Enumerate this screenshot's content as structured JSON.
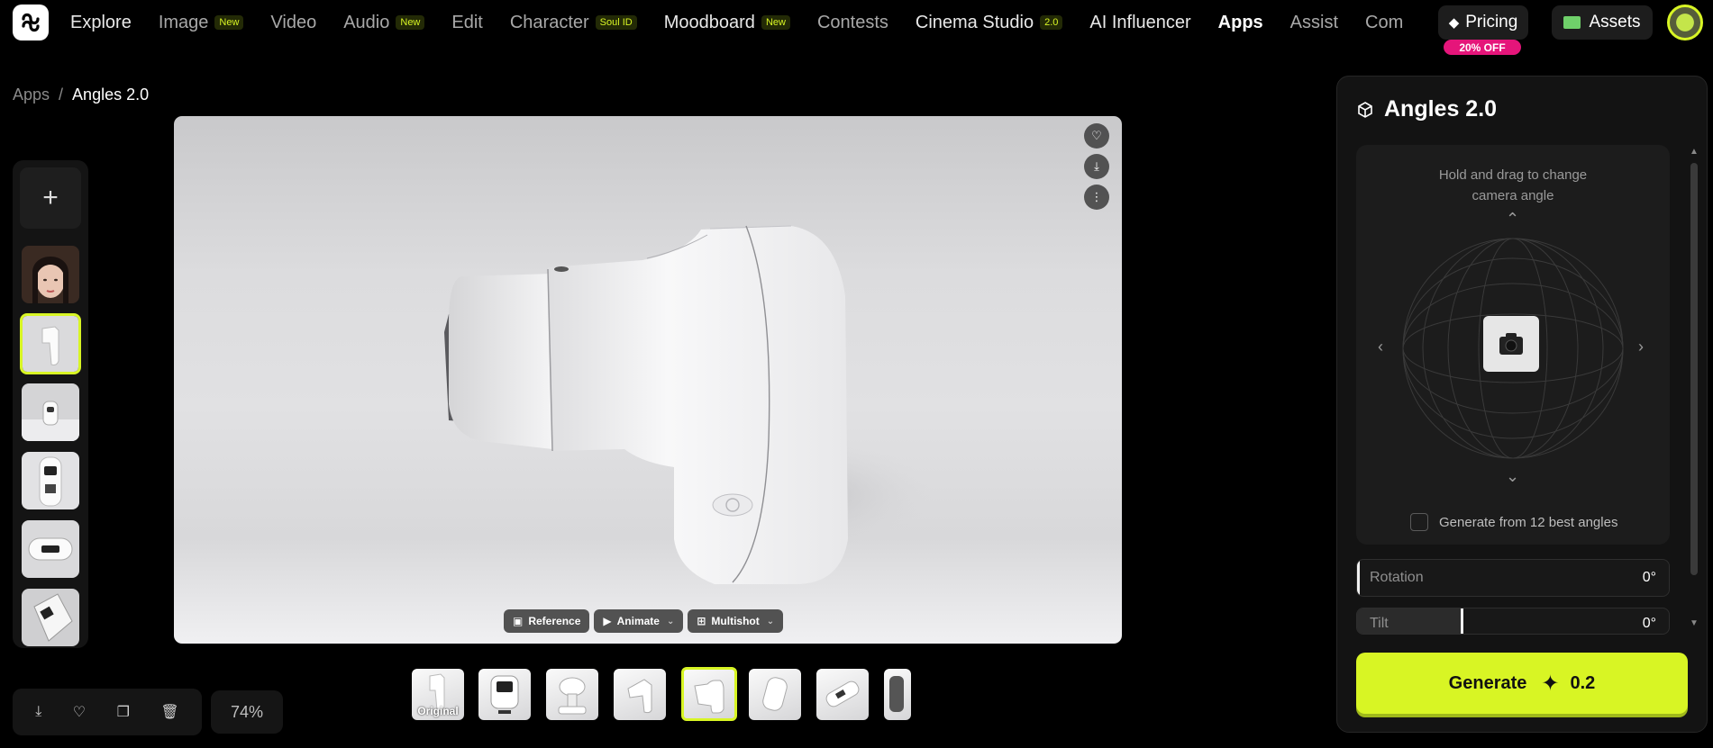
{
  "nav": {
    "items": [
      {
        "label": "Explore",
        "badge": null,
        "style": "bold"
      },
      {
        "label": "Image",
        "badge": "New",
        "style": ""
      },
      {
        "label": "Video",
        "badge": null,
        "style": ""
      },
      {
        "label": "Audio",
        "badge": "New",
        "style": ""
      },
      {
        "label": "Edit",
        "badge": null,
        "style": ""
      },
      {
        "label": "Character",
        "badge": "Soul ID",
        "style": ""
      },
      {
        "label": "Moodboard",
        "badge": "New",
        "style": "bold"
      },
      {
        "label": "Contests",
        "badge": null,
        "style": ""
      },
      {
        "label": "Cinema Studio",
        "badge": "2.0",
        "style": "bold"
      },
      {
        "label": "AI Influencer",
        "badge": null,
        "style": "bold"
      },
      {
        "label": "Apps",
        "badge": null,
        "style": "active"
      },
      {
        "label": "Assist",
        "badge": null,
        "style": ""
      },
      {
        "label": "Com",
        "badge": null,
        "style": ""
      }
    ],
    "pricing_label": "Pricing",
    "pricing_offer": "20% OFF",
    "assets_label": "Assets"
  },
  "breadcrumb": {
    "parent": "Apps",
    "separator": "/",
    "current": "Angles 2.0"
  },
  "sidebar": {
    "add_symbol": "+"
  },
  "viewer": {
    "tools": [
      {
        "label": "Reference",
        "icon": "image-icon",
        "dropdown": false
      },
      {
        "label": "Animate",
        "icon": "video-icon",
        "dropdown": true
      },
      {
        "label": "Multishot",
        "icon": "grid-icon",
        "dropdown": true
      }
    ]
  },
  "gallery": {
    "original_label": "Original"
  },
  "zoom": "74%",
  "panel": {
    "title": "Angles 2.0",
    "hint_line1": "Hold and drag to change",
    "hint_line2": "camera angle",
    "generate_best_label": "Generate from 12 best angles",
    "rotation_label": "Rotation",
    "rotation_value": "0°",
    "tilt_label": "Tilt",
    "tilt_value": "0°",
    "tilt_level": 0.33
  },
  "generate": {
    "label": "Generate",
    "cost": "0.2"
  },
  "colors": {
    "accent": "#d8f524",
    "offer": "#e5157a"
  }
}
